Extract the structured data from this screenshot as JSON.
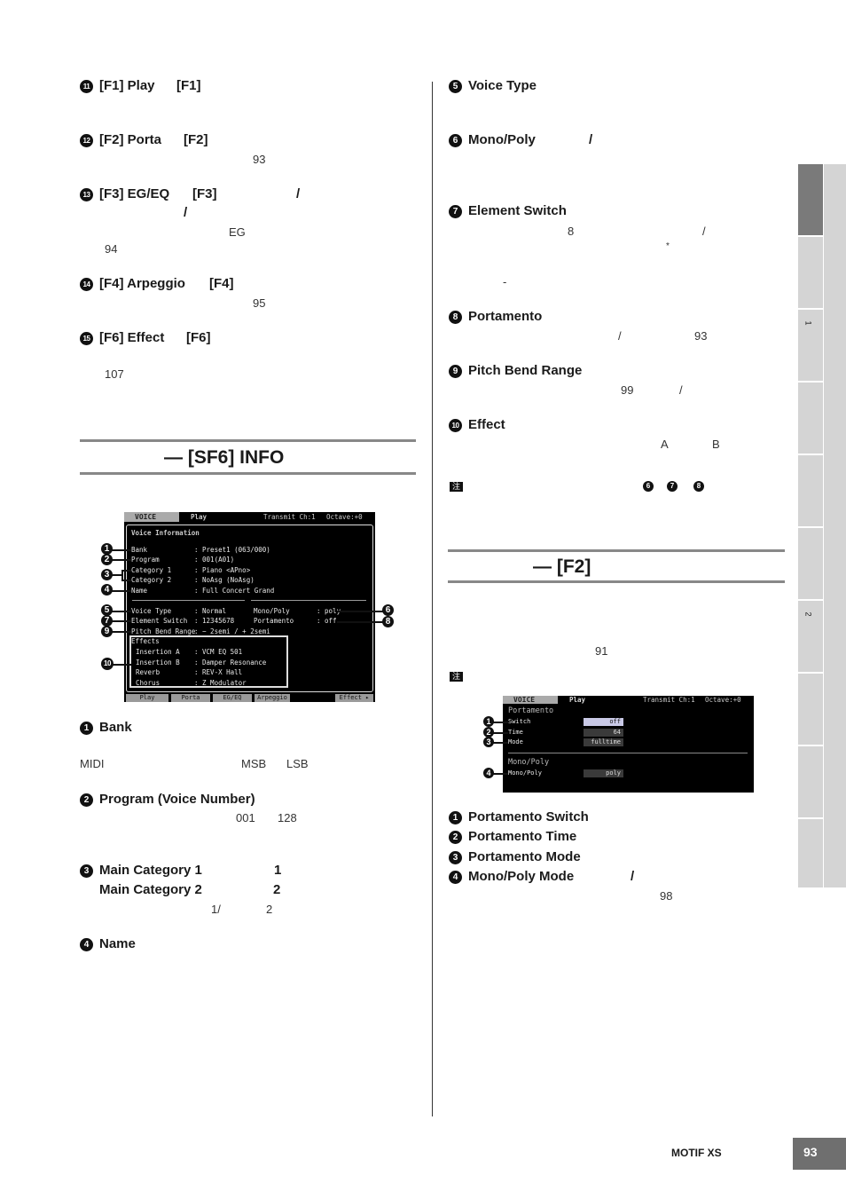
{
  "left": {
    "h11": {
      "num": "11",
      "title": "[F1] Play",
      "key": "[F1]"
    },
    "h12": {
      "num": "12",
      "title": "[F2] Porta",
      "key": "[F2]",
      "page": "93"
    },
    "h13": {
      "num": "13",
      "title": "[F3] EG/EQ",
      "key": "[F3]",
      "slash1": "/",
      "slash2": "/",
      "eg": "EG",
      "page": "94"
    },
    "h14": {
      "num": "14",
      "title": "[F4] Arpeggio",
      "key": "[F4]",
      "page": "95"
    },
    "h15": {
      "num": "15",
      "title": "[F6] Effect",
      "key": "[F6]",
      "page": "107"
    },
    "section_title": "— [SF6] INFO",
    "bank": {
      "num": "1",
      "title": "Bank",
      "midi": "MIDI",
      "msb": "MSB",
      "lsb": "LSB"
    },
    "program": {
      "num": "2",
      "title": "Program (Voice Number)",
      "from": "001",
      "to": "128"
    },
    "category": {
      "num": "3",
      "title1": "Main Category 1",
      "n1": "1",
      "title2": "Main Category 2",
      "n2": "2",
      "ref1": "1/",
      "ref2": "2"
    },
    "name": {
      "num": "4",
      "title": "Name"
    }
  },
  "lcd1": {
    "mode": "VOICE",
    "tab": "Play",
    "transmit": "Transmit Ch:1",
    "octave": "Octave:+0",
    "heading": "Voice Information",
    "rows": [
      {
        "label": "Bank",
        "value": ": Preset1 (063/000)"
      },
      {
        "label": "Program",
        "value": ": 001(A01)"
      },
      {
        "label": "Category 1",
        "value": ": Piano <APno>"
      },
      {
        "label": "Category 2",
        "value": ": NoAsg (NoAsg)"
      },
      {
        "label": "Name",
        "value": ": Full Concert Grand"
      }
    ],
    "rows2": [
      {
        "label": "Voice Type",
        "value": ": Normal",
        "label2": "Mono/Poly",
        "value2": ": poly"
      },
      {
        "label": "Element Switch",
        "value": ": 12345678",
        "label2": "Portamento",
        "value2": ": off"
      },
      {
        "label": "Pitch Bend Range",
        "value": ": − 2semi / + 2semi"
      }
    ],
    "effects_label": "Effects",
    "effects": [
      {
        "label": "Insertion A",
        "value": ": VCM EQ 501"
      },
      {
        "label": "Insertion B",
        "value": ": Damper Resonance"
      },
      {
        "label": "Reverb",
        "value": ": REV-X Hall"
      },
      {
        "label": "Chorus",
        "value": ": Z Modulator"
      }
    ],
    "footer_tabs": [
      "Play",
      "Porta",
      "EG/EQ",
      "Arpeggio",
      "Effect ▸"
    ],
    "callouts": [
      "1",
      "2",
      "3",
      "4",
      "5",
      "7",
      "9",
      "10",
      "6",
      "8"
    ]
  },
  "right": {
    "voice_type": {
      "num": "5",
      "title": "Voice Type"
    },
    "mono_poly": {
      "num": "6",
      "title": "Mono/Poly",
      "slash": "/"
    },
    "element_switch": {
      "num": "7",
      "title": "Element Switch",
      "eight": "8",
      "slash": "/",
      "star": "*",
      "dash": "-"
    },
    "portamento": {
      "num": "8",
      "title": "Portamento",
      "slash": "/",
      "page": "93"
    },
    "pitch_bend": {
      "num": "9",
      "title": "Pitch Bend Range",
      "page": "99",
      "slash": "/"
    },
    "effect": {
      "num": "10",
      "title": "Effect",
      "a": "A",
      "b": "B"
    },
    "note_label": "注",
    "note_refs": [
      "6",
      "7",
      "8"
    ],
    "section_title": "— [F2]",
    "page_ref": "91",
    "note2_label": "注",
    "list": [
      {
        "num": "1",
        "title": "Portamento Switch"
      },
      {
        "num": "2",
        "title": "Portamento Time"
      },
      {
        "num": "3",
        "title": "Portamento Mode"
      },
      {
        "num": "4",
        "title": "Mono/Poly Mode",
        "slash": "/"
      }
    ],
    "list_page": "98"
  },
  "lcd2": {
    "mode": "VOICE",
    "tab": "Play",
    "transmit": "Transmit Ch:1",
    "octave": "Octave:+0",
    "group1": "Portamento",
    "rows": [
      {
        "label": "Switch",
        "value": "off"
      },
      {
        "label": "Time",
        "value": "64"
      },
      {
        "label": "Mode",
        "value": "fulltime"
      }
    ],
    "group2": "Mono/Poly",
    "row4": {
      "label": "Mono/Poly",
      "value": "poly"
    },
    "callouts": [
      "1",
      "2",
      "3",
      "4"
    ]
  },
  "side_tabs": [
    "1",
    "2"
  ],
  "footer": {
    "product": "MOTIF XS",
    "page": "93"
  }
}
